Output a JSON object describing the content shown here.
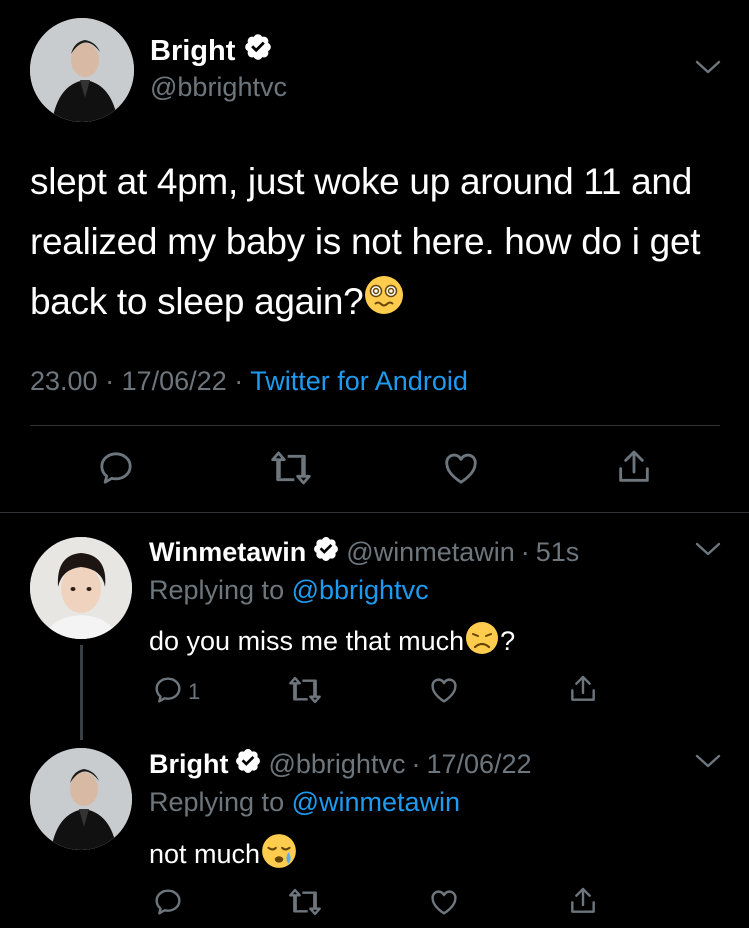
{
  "main_tweet": {
    "name": "Bright",
    "handle": "@bbrightvc",
    "text": "slept at 4pm, just woke up around 11 and realized my baby is not here. how do i get back to sleep again?",
    "time": "23.00",
    "date": "17/06/22",
    "source": "Twitter for Android",
    "sep": "·",
    "emoji": "woozy-face"
  },
  "reply1": {
    "name": "Winmetawin",
    "handle": "@winmetawin",
    "sep": "·",
    "age": "51s",
    "replying_label": "Replying to",
    "replying_to": "@bbrightvc",
    "text": "do you miss me that much",
    "text_suffix": "?",
    "emoji": "disappointed-face",
    "reply_count": "1"
  },
  "reply2": {
    "name": "Bright",
    "handle": "@bbrightvc",
    "sep": "·",
    "date": "17/06/22",
    "replying_label": "Replying to",
    "replying_to": "@winmetawin",
    "text": "not much",
    "emoji": "sleepy-face"
  },
  "colors": {
    "background": "#000000",
    "link": "#1d9bf0",
    "muted": "#6e767d",
    "verified": "#ffffff"
  }
}
